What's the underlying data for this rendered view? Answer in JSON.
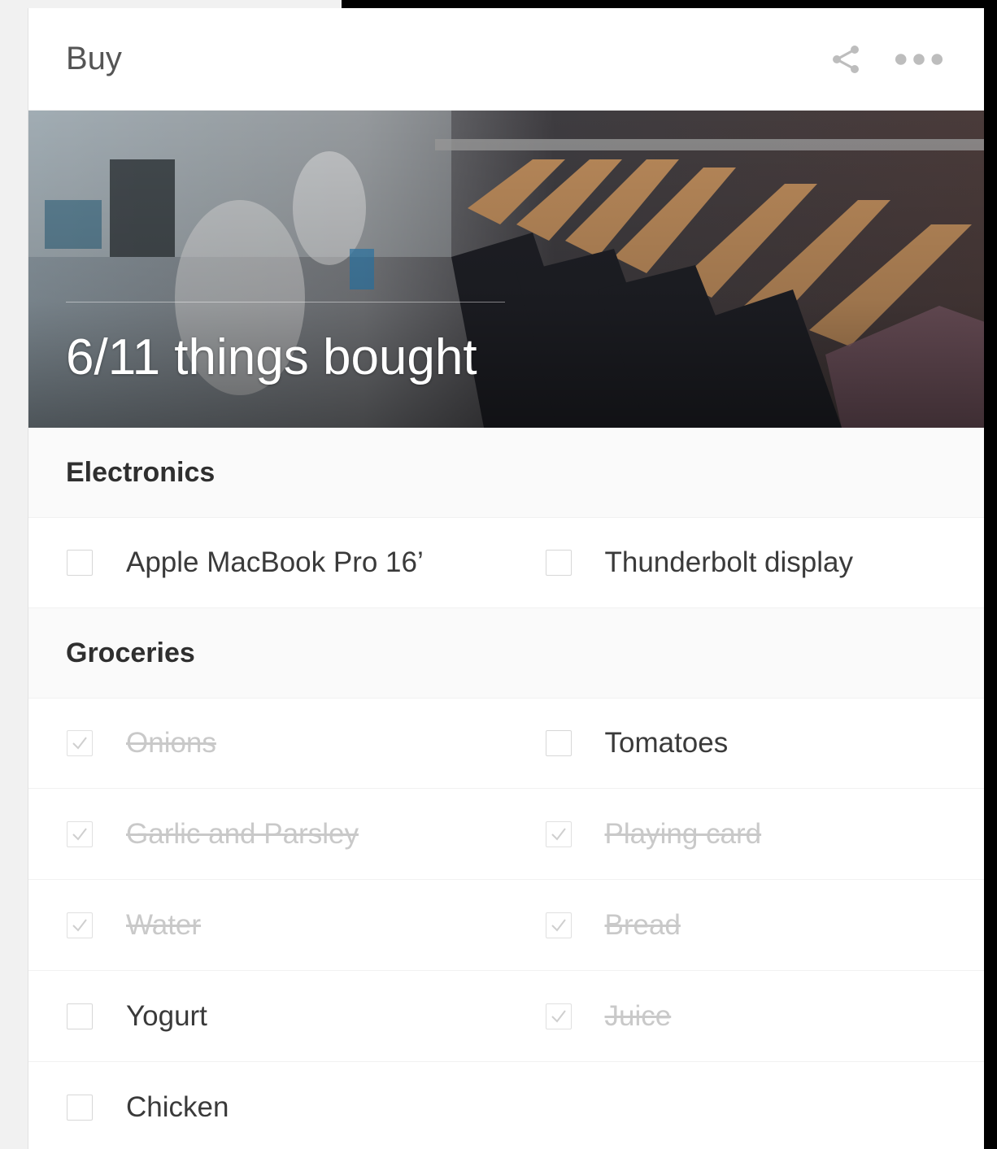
{
  "list": {
    "title": "Buy",
    "progress_text": "6/11 things bought"
  },
  "icons": {
    "share": "share-icon",
    "more": "more-dots-icon",
    "checkbox": "checkbox-icon",
    "checkmark": "checkmark-icon"
  },
  "colors": {
    "section_bg": "#fafafa",
    "done_text": "#c9c9c9",
    "text": "#3a3a3a"
  },
  "sections": [
    {
      "name": "Electronics",
      "items": [
        {
          "label": "Apple MacBook Pro 16’",
          "done": false
        },
        {
          "label": "Thunderbolt display",
          "done": false
        }
      ]
    },
    {
      "name": "Groceries",
      "items": [
        {
          "label": "Onions",
          "done": true
        },
        {
          "label": "Tomatoes",
          "done": false
        },
        {
          "label": "Garlic and Parsley",
          "done": true
        },
        {
          "label": "Playing card",
          "done": true
        },
        {
          "label": "Water",
          "done": true
        },
        {
          "label": "Bread",
          "done": true
        },
        {
          "label": "Yogurt",
          "done": false
        },
        {
          "label": "Juice",
          "done": true
        },
        {
          "label": "Chicken",
          "done": false
        }
      ]
    }
  ]
}
